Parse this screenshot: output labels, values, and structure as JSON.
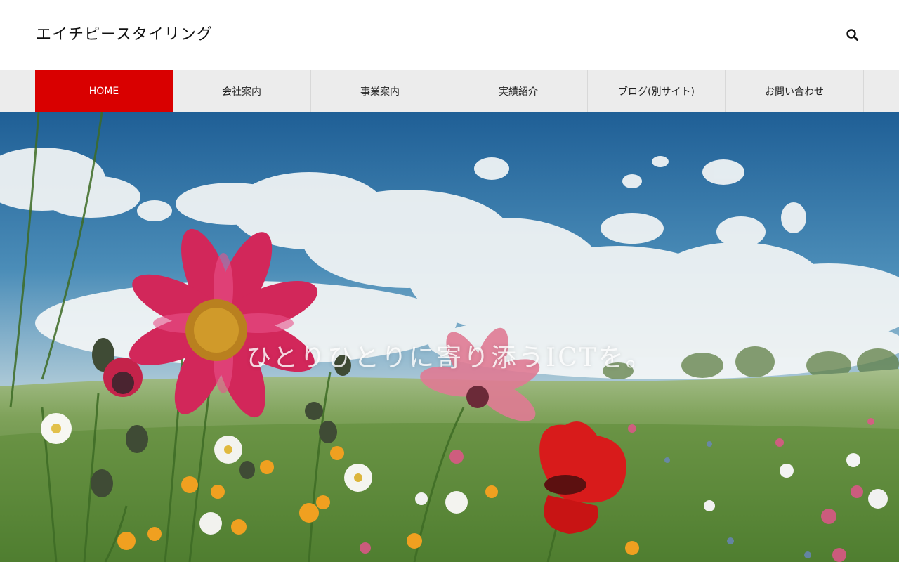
{
  "header": {
    "site_title": "エイチピースタイリング",
    "search_icon": "search-icon"
  },
  "nav": {
    "items": [
      {
        "label": "HOME",
        "active": true
      },
      {
        "label": "会社案内",
        "active": false
      },
      {
        "label": "事業案内",
        "active": false
      },
      {
        "label": "実績紹介",
        "active": false
      },
      {
        "label": "ブログ(別サイト)",
        "active": false
      },
      {
        "label": "お問い合わせ",
        "active": false
      }
    ]
  },
  "hero": {
    "tagline": "ひとりひとりに寄り添うICTを。"
  },
  "colors": {
    "accent": "#d90000",
    "nav_bg": "#ececec",
    "sky_top": "#2f6fa5",
    "meadow": "#5f8f3a"
  }
}
